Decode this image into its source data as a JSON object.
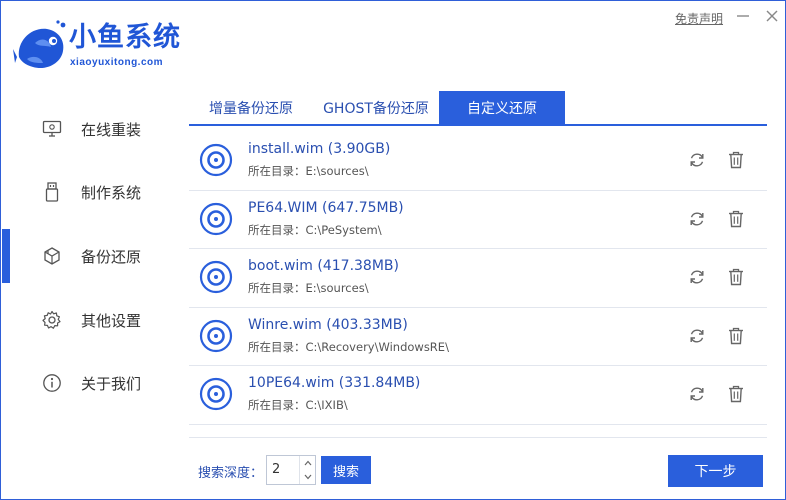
{
  "app": {
    "title": "小鱼系统",
    "url": "xiaoyuxitong.com",
    "disclaimer": "免责声明",
    "minimize_icon": "minimize-icon",
    "close_icon": "close-icon",
    "accent_color": "#2a5fdc"
  },
  "sidebar": {
    "items": [
      {
        "label": "在线重装",
        "icon": "monitor-icon",
        "active": false
      },
      {
        "label": "制作系统",
        "icon": "usb-drive-icon",
        "active": false
      },
      {
        "label": "备份还原",
        "icon": "cube-backup-icon",
        "active": true
      },
      {
        "label": "其他设置",
        "icon": "gear-icon",
        "active": false
      },
      {
        "label": "关于我们",
        "icon": "info-icon",
        "active": false
      }
    ]
  },
  "tabs": [
    {
      "label": "增量备份还原",
      "active": false
    },
    {
      "label": "GHOST备份还原",
      "active": false
    },
    {
      "label": "自定义还原",
      "active": true
    }
  ],
  "list": {
    "path_label": "所在目录：",
    "items": [
      {
        "title": "install.wim (3.90GB)",
        "path": "E:\\sources\\"
      },
      {
        "title": "PE64.WIM (647.75MB)",
        "path": "C:\\PeSystem\\"
      },
      {
        "title": "boot.wim (417.38MB)",
        "path": "E:\\sources\\"
      },
      {
        "title": "Winre.wim (403.33MB)",
        "path": "C:\\Recovery\\WindowsRE\\"
      },
      {
        "title": "10PE64.wim (331.84MB)",
        "path": "C:\\IXIB\\"
      }
    ]
  },
  "footer": {
    "depth_label": "搜索深度：",
    "depth_value": "2",
    "search_label": "搜索",
    "next_label": "下一步"
  }
}
